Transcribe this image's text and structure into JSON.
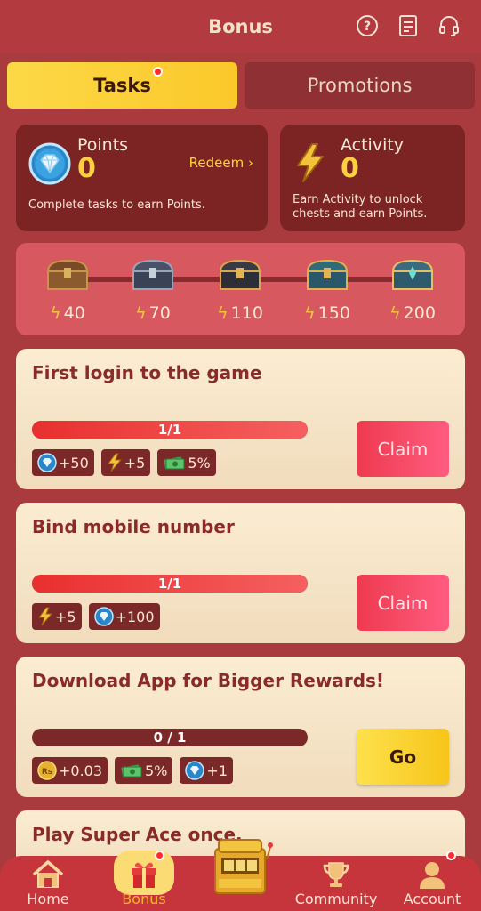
{
  "header": {
    "title": "Bonus",
    "icons": [
      "help-icon",
      "document-icon",
      "headset-icon"
    ]
  },
  "tabs": [
    {
      "label": "Tasks",
      "active": true,
      "badge": true
    },
    {
      "label": "Promotions",
      "active": false
    }
  ],
  "points_card": {
    "label": "Points",
    "value": "0",
    "redeem": "Redeem",
    "description": "Complete tasks to earn Points."
  },
  "activity_card": {
    "label": "Activity",
    "value": "0",
    "description_line1": "Earn Activity to unlock",
    "description_line2": "chests and earn Points."
  },
  "chests": [
    {
      "level": "40"
    },
    {
      "level": "70"
    },
    {
      "level": "110"
    },
    {
      "level": "150"
    },
    {
      "level": "200"
    }
  ],
  "tasks": [
    {
      "title": "First login to the game",
      "progress_text": "1/1",
      "progress_fraction": 1.0,
      "rewards": [
        {
          "icon": "diamond-icon",
          "text": "+50"
        },
        {
          "icon": "bolt-icon",
          "text": "+5"
        },
        {
          "icon": "cash-icon",
          "text": "5%"
        }
      ],
      "action": "Claim"
    },
    {
      "title": "Bind mobile number",
      "progress_text": "1/1",
      "progress_fraction": 1.0,
      "rewards": [
        {
          "icon": "bolt-icon",
          "text": "+5"
        },
        {
          "icon": "diamond-icon",
          "text": "+100"
        }
      ],
      "action": "Claim"
    },
    {
      "title": "Download App for Bigger Rewards!",
      "progress_text": "0 / 1",
      "progress_fraction": 0.0,
      "rewards": [
        {
          "icon": "rupee-coin-icon",
          "text": "+0.03"
        },
        {
          "icon": "cash-icon",
          "text": "5%"
        },
        {
          "icon": "diamond-icon",
          "text": "+1"
        }
      ],
      "action": "Go"
    },
    {
      "title": "Play Super Ace once."
    }
  ],
  "nav": {
    "items": [
      {
        "label": "Home"
      },
      {
        "label": "Bonus"
      },
      {
        "label": ""
      },
      {
        "label": "Community"
      },
      {
        "label": "Account"
      }
    ]
  },
  "colors": {
    "background": "#a93a3d",
    "header": "#b33a3e",
    "gold": "#fcd23c",
    "claim": "#ee3a4f",
    "card": "#fbecd2"
  }
}
